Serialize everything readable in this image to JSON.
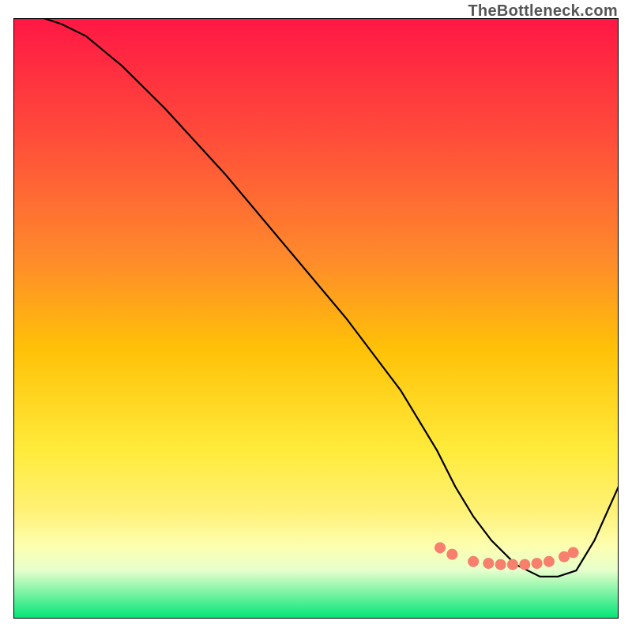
{
  "watermark": "TheBottleneck.com",
  "chart_data": {
    "type": "line",
    "title": "",
    "xlabel": "",
    "ylabel": "",
    "xlim": [
      0,
      100
    ],
    "ylim": [
      0,
      100
    ],
    "gradient_stops": [
      {
        "offset": 0,
        "color": "#ff1744"
      },
      {
        "offset": 20,
        "color": "#ff4d3a"
      },
      {
        "offset": 40,
        "color": "#ff8a2b"
      },
      {
        "offset": 55,
        "color": "#ffc107"
      },
      {
        "offset": 72,
        "color": "#ffeb3b"
      },
      {
        "offset": 82,
        "color": "#fff176"
      },
      {
        "offset": 88,
        "color": "#fdffb0"
      },
      {
        "offset": 92,
        "color": "#e6ffcc"
      },
      {
        "offset": 100,
        "color": "#00e676"
      }
    ],
    "curve": {
      "x": [
        0,
        5,
        8,
        12,
        18,
        25,
        35,
        45,
        55,
        64,
        70,
        73,
        76,
        79,
        83,
        87,
        90,
        93,
        96,
        100
      ],
      "y": [
        100,
        100,
        99,
        97,
        92,
        85,
        74,
        62,
        50,
        38,
        28,
        22,
        17,
        13,
        9,
        7,
        7,
        8,
        13,
        22
      ]
    },
    "markers": {
      "x": [
        70.5,
        72.5,
        76,
        78.5,
        80.5,
        82.5,
        84.5,
        86.5,
        88.5,
        91,
        92.5
      ],
      "y": [
        11.8,
        10.7,
        9.5,
        9.2,
        9.0,
        9.0,
        9.0,
        9.2,
        9.5,
        10.3,
        11.0
      ]
    },
    "marker_color": "#f77f6e",
    "curve_color": "#000000"
  }
}
